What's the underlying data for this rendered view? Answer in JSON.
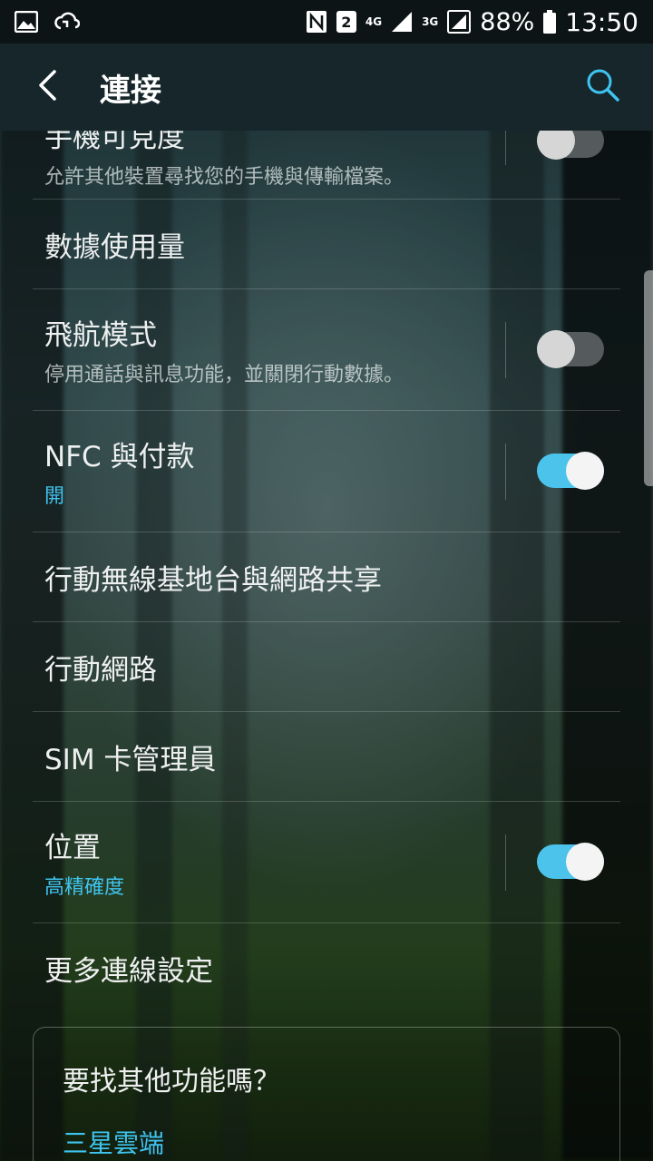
{
  "status_bar": {
    "network_labels": [
      "4G",
      "3G"
    ],
    "sim_badge": "2",
    "battery": "88%",
    "time": "13:50"
  },
  "app_bar": {
    "title": "連接"
  },
  "rows": [
    {
      "title": "手機可見度",
      "subtitle": "允許其他裝置尋找您的手機與傳輸檔案。",
      "toggle": "off"
    },
    {
      "title": "數據使用量"
    },
    {
      "title": "飛航模式",
      "subtitle": "停用通話與訊息功能，並關閉行動數據。",
      "toggle": "off"
    },
    {
      "title": "NFC 與付款",
      "subtitle": "開",
      "toggle": "on"
    },
    {
      "title": "行動無線基地台與網路共享"
    },
    {
      "title": "行動網路"
    },
    {
      "title": "SIM 卡管理員"
    },
    {
      "title": "位置",
      "subtitle": "高精確度",
      "toggle": "on"
    },
    {
      "title": "更多連線設定"
    }
  ],
  "suggestion_card": {
    "title": "要找其他功能嗎？",
    "link": "三星雲端"
  },
  "colors": {
    "accent": "#3fc4f0",
    "toggle_on": "#4cc3ea",
    "toggle_off": "#555b5d"
  }
}
